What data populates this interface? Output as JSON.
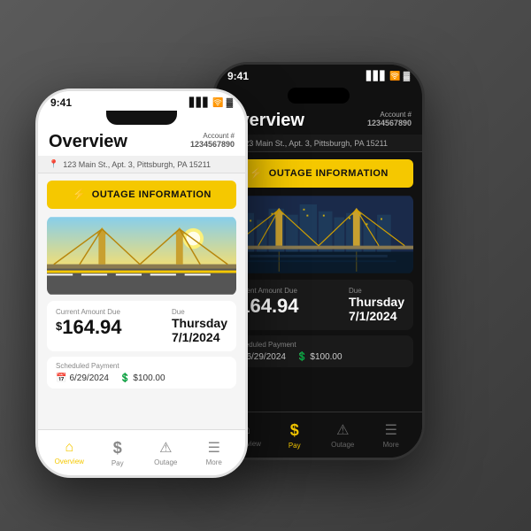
{
  "white_phone": {
    "status_bar": {
      "time": "9:41",
      "icons": "▋▋ ◂ 🔋"
    },
    "header": {
      "title": "Overview",
      "account_label": "Account #",
      "account_number": "1234567890"
    },
    "address": "123 Main St., Apt. 3, Pittsburgh, PA 15211",
    "outage_banner": "OUTAGE INFORMATION",
    "billing": {
      "amount_label": "Current Amount Due",
      "amount": "164.94",
      "due_label": "Due",
      "due_day": "Thursday",
      "due_date": "7/1/2024"
    },
    "scheduled": {
      "label": "Scheduled Payment",
      "date": "6/29/2024",
      "amount": "$100.00"
    },
    "nav": [
      {
        "label": "Overview",
        "active": true
      },
      {
        "label": "Pay",
        "active": false
      },
      {
        "label": "Outage",
        "active": false
      },
      {
        "label": "More",
        "active": false
      }
    ]
  },
  "black_phone": {
    "status_bar": {
      "time": "9:41",
      "icons": "▋▋ ◂ 🔋"
    },
    "header": {
      "title": "Overview",
      "account_label": "Account #",
      "account_number": "1234567890"
    },
    "address": "123 Main St., Apt. 3, Pittsburgh, PA 15211",
    "outage_banner": "OUTAGE INFORMATION",
    "billing": {
      "amount_label": "Current Amount Due",
      "amount": "164.94",
      "due_label": "Due",
      "due_day": "Thursday",
      "due_date": "7/1/2024"
    },
    "scheduled": {
      "label": "Scheduled Payment",
      "date": "6/29/2024",
      "amount": "$100.00"
    },
    "nav": [
      {
        "label": "Overview",
        "active": false
      },
      {
        "label": "Pay",
        "active": true
      },
      {
        "label": "Outage",
        "active": false
      },
      {
        "label": "More",
        "active": false
      }
    ]
  },
  "icons": {
    "home": "⌂",
    "pay": "$",
    "outage": "⚠",
    "more": "☰",
    "lightning": "⚡",
    "calendar": "📅",
    "dollar": "$",
    "location": "📍",
    "signal": "📶",
    "wifi": "🛜",
    "battery": "🔋"
  }
}
